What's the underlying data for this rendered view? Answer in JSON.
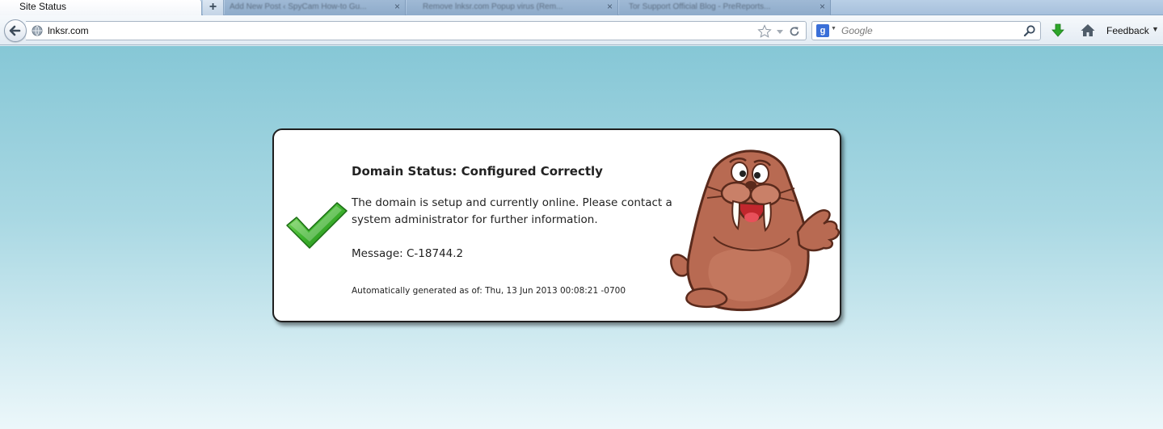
{
  "tabs": {
    "active_title": "Site Status",
    "new_tab_symbol": "+",
    "background_tabs": [
      {
        "title": "Add New Post ‹ SpyCam How-to Gu..."
      },
      {
        "title": "Remove lnksr.com Popup virus (Rem..."
      },
      {
        "title": "Tor Support Official Blog - PreReports..."
      }
    ],
    "close_symbol": "×"
  },
  "navbar": {
    "url": "lnksr.com",
    "search_placeholder": "Google",
    "search_engine_letter": "g",
    "feedback_label": "Feedback"
  },
  "card": {
    "title": "Domain Status: Configured Correctly",
    "description": "The domain is setup and currently online. Please contact a system administrator for further information.",
    "message": "Message: C-18744.2",
    "generated": "Automatically generated as of: Thu, 13 Jun 2013 00:08:21 -0700"
  },
  "icons": [
    "back-arrow-icon",
    "globe-icon",
    "star-icon",
    "dropdown-arrow-icon",
    "reload-icon",
    "google-icon",
    "search-icon",
    "download-icon",
    "home-icon",
    "checkmark-icon",
    "walrus-mascot"
  ],
  "colors": {
    "page_gradient_top": "#86c7d6",
    "page_gradient_bottom": "#ecf7fa",
    "check_green": "#3fb52f",
    "download_green": "#2ea62a"
  }
}
